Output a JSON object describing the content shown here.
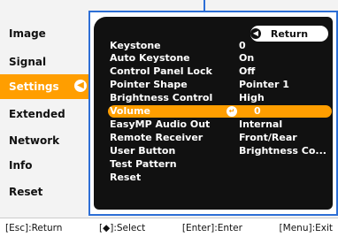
{
  "sidebar": {
    "items": [
      {
        "label": "Image"
      },
      {
        "label": "Signal"
      },
      {
        "label": "Settings",
        "selected": true
      },
      {
        "label": "Extended"
      },
      {
        "label": "Network"
      },
      {
        "label": "Info"
      },
      {
        "label": "Reset"
      }
    ]
  },
  "panel": {
    "return_label": "Return",
    "rows": [
      {
        "label": "Keystone",
        "value": "0"
      },
      {
        "label": "Auto Keystone",
        "value": "On"
      },
      {
        "label": "Control Panel Lock",
        "value": "Off"
      },
      {
        "label": "Pointer Shape",
        "value": "Pointer 1"
      },
      {
        "label": "Brightness Control",
        "value": "High"
      },
      {
        "label": "Volume",
        "value": "0",
        "highlighted": true
      },
      {
        "label": "EasyMP Audio Out",
        "value": "Internal"
      },
      {
        "label": "Remote Receiver",
        "value": "Front/Rear"
      },
      {
        "label": "User Button",
        "value": "Brightness Co..."
      },
      {
        "label": "Test Pattern",
        "value": ""
      },
      {
        "label": "Reset",
        "value": ""
      }
    ]
  },
  "footer": {
    "esc": "[Esc]:Return",
    "select": "[◆]:Select",
    "enter": "[Enter]:Enter",
    "menu": "[Menu]:Exit"
  },
  "colors": {
    "accent": "#ff9e00",
    "frame": "#2d6fd6",
    "panel_bg": "#111111"
  }
}
